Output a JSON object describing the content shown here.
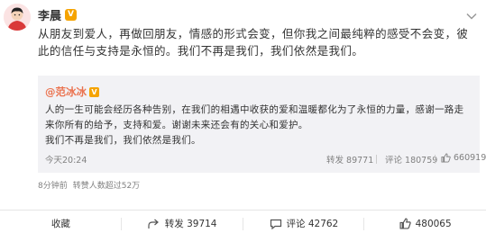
{
  "author": {
    "name": "李晨",
    "verified_badge": "V",
    "avatar_icon": "avatar-icon",
    "badge_color": "#f5a300"
  },
  "post": {
    "text": "从朋友到爱人，再做回朋友，情感的形式会变，但你我之间最纯粹的感受不会变，彼此的信任与支持是永恒的。我们不再是我们，我们依然是我们。",
    "time": "8分钟前",
    "reach": "转赞人数超过52万"
  },
  "repost": {
    "author": "@范冰冰",
    "verified_badge": "V",
    "text_line1": "人的一生可能会经历各种告别，在我们的相遇中收获的爱和温暖都化为了永恒的力量，感谢一路走来你所有的给予，支持和爱。谢谢未来还会有的关心和爱护。",
    "text_line2": "我们不再是我们，我们依然是我们。",
    "time": "今天20:24",
    "share_label": "转发 89771",
    "comment_label": "评论 180759",
    "like_count": "660919",
    "author_color": "#eb7350"
  },
  "actions": {
    "favorite_label": "收藏",
    "share_label": "转发 39714",
    "comment_label": "评论 42762",
    "like_count": "480065"
  }
}
